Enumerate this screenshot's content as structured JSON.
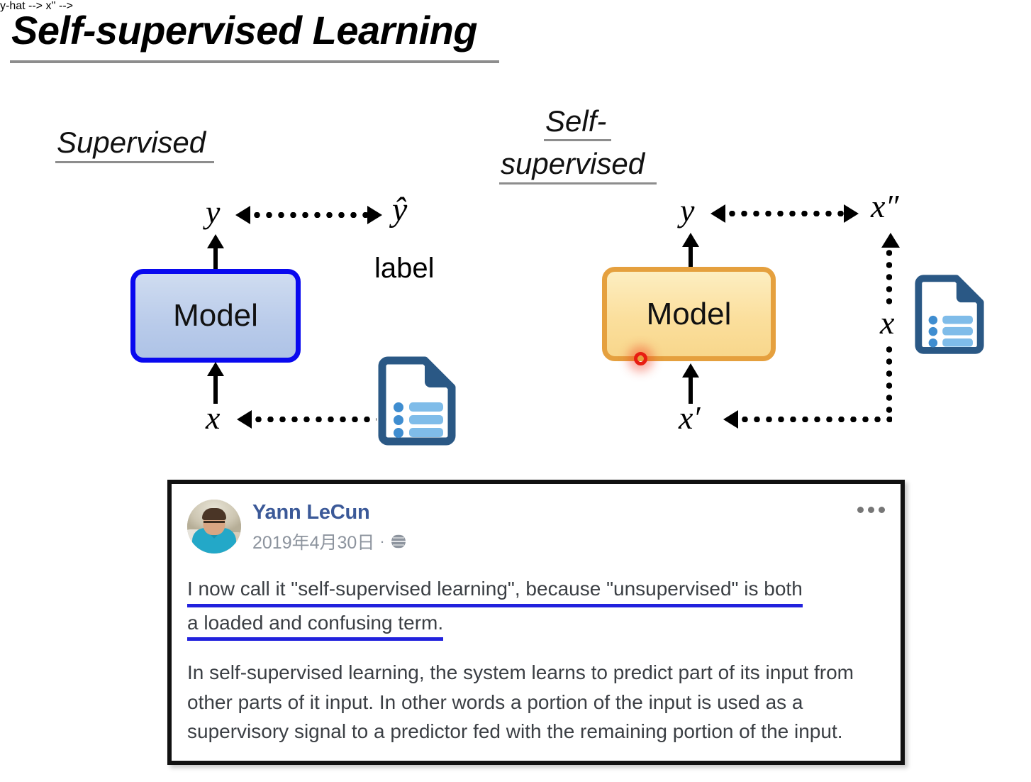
{
  "slide": {
    "title": "Self-supervised Learning"
  },
  "supervised": {
    "heading": "Supervised",
    "model_label": "Model",
    "output_label": "y",
    "target_label": "ŷ",
    "target_caption": "label",
    "input_label": "x",
    "box_border_color": "#0909ef",
    "box_fill_color": "#b9cbea",
    "doc_icon_name": "document-icon"
  },
  "self_supervised": {
    "heading_line1": "Self-",
    "heading_line2": "supervised",
    "model_label": "Model",
    "output_label": "y",
    "target_label": "x″",
    "input_label": "x′",
    "source_label": "x",
    "box_border_color": "#e5a03e",
    "box_fill_color": "#fbdf9d",
    "laser_color": "#e81d12",
    "doc_icon_name": "document-icon"
  },
  "fb_post": {
    "author": "Yann LeCun",
    "date": "2019年4月30日",
    "separator": "·",
    "privacy_icon": "globe-icon",
    "more_icon": "more-options-icon",
    "quote_lines": [
      "I now call it \"self-supervised learning\", because \"unsupervised\" is both",
      "a loaded and confusing term."
    ],
    "paragraph": "In self-supervised learning, the system learns to predict part of its input from other parts of it input. In other words a portion of the input is used as a supervisory signal to a predictor fed with the remaining portion of the input.",
    "author_color": "#3b5998",
    "quote_underline_color": "#2222dd",
    "body_text_color": "#3b3f44"
  }
}
